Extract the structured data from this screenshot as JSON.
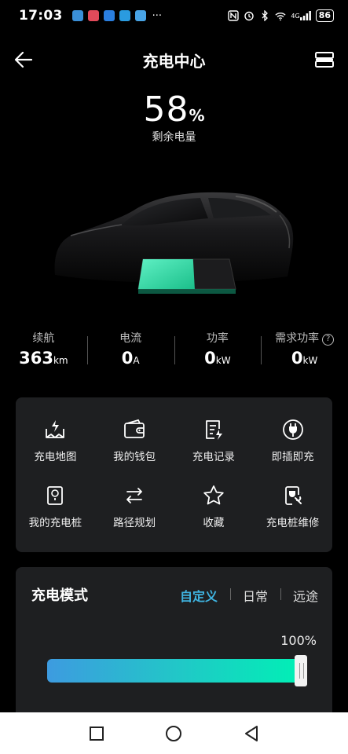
{
  "status_bar": {
    "time": "17:03",
    "more": "···",
    "network": "4G",
    "battery": "86"
  },
  "header": {
    "title": "充电中心"
  },
  "charge": {
    "percent": "58",
    "percent_unit": "%",
    "label": "剩余电量",
    "level": 0.58
  },
  "stats": [
    {
      "label": "续航",
      "value": "363",
      "unit": "km"
    },
    {
      "label": "电流",
      "value": "0",
      "unit": "A"
    },
    {
      "label": "功率",
      "value": "0",
      "unit": "kW"
    },
    {
      "label": "需求功率",
      "value": "0",
      "unit": "kW"
    }
  ],
  "grid": [
    {
      "label": "充电地图",
      "icon": "charging-map-icon"
    },
    {
      "label": "我的钱包",
      "icon": "wallet-icon"
    },
    {
      "label": "充电记录",
      "icon": "charge-record-icon"
    },
    {
      "label": "即插即充",
      "icon": "plug-and-charge-icon"
    },
    {
      "label": "我的充电桩",
      "icon": "charging-pile-icon"
    },
    {
      "label": "路径规划",
      "icon": "route-planning-icon"
    },
    {
      "label": "收藏",
      "icon": "star-icon"
    },
    {
      "label": "充电桩维修",
      "icon": "pile-repair-icon"
    }
  ],
  "mode": {
    "title": "充电模式",
    "tabs": [
      "自定义",
      "日常",
      "远途"
    ],
    "active_tab": "自定义",
    "limit_label": "100%",
    "limit_value": 100
  },
  "colors": {
    "accent": "#3fb3e0",
    "battery_green": "#2ee0a8",
    "slider_start": "#3d9be0",
    "slider_end": "#00f0b5"
  }
}
